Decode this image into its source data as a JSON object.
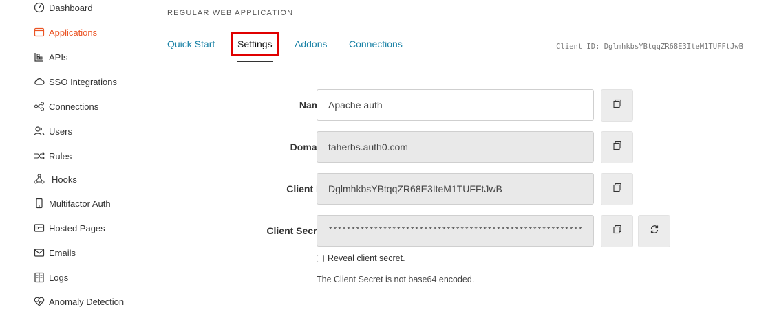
{
  "sidebar": {
    "items": [
      {
        "label": "Dashboard",
        "icon": "dashboard-icon",
        "active": false
      },
      {
        "label": "Applications",
        "icon": "applications-icon",
        "active": true
      },
      {
        "label": "APIs",
        "icon": "apis-icon",
        "active": false
      },
      {
        "label": "SSO Integrations",
        "icon": "cloud-icon",
        "active": false
      },
      {
        "label": "Connections",
        "icon": "connections-icon",
        "active": false
      },
      {
        "label": "Users",
        "icon": "users-icon",
        "active": false
      },
      {
        "label": "Rules",
        "icon": "rules-icon",
        "active": false
      },
      {
        "label": "Hooks",
        "icon": "hooks-icon",
        "active": false
      },
      {
        "label": "Multifactor Auth",
        "icon": "phone-icon",
        "active": false
      },
      {
        "label": "Hosted Pages",
        "icon": "hosted-pages-icon",
        "active": false
      },
      {
        "label": "Emails",
        "icon": "mail-icon",
        "active": false
      },
      {
        "label": "Logs",
        "icon": "logs-icon",
        "active": false
      },
      {
        "label": "Anomaly Detection",
        "icon": "heart-icon",
        "active": false
      }
    ]
  },
  "header": {
    "app_type": "REGULAR WEB APPLICATION",
    "client_id_label": "Client ID: DglmhkbsYBtqqZR68E3IteM1TUFFtJwB"
  },
  "tabs": [
    {
      "label": "Quick Start",
      "active": false
    },
    {
      "label": "Settings",
      "active": true
    },
    {
      "label": "Addons",
      "active": false
    },
    {
      "label": "Connections",
      "active": false
    }
  ],
  "form": {
    "name": {
      "label": "Name",
      "value": "Apache auth"
    },
    "domain": {
      "label": "Domain",
      "value": "taherbs.auth0.com"
    },
    "client_id": {
      "label": "Client ID",
      "value": "DglmhkbsYBtqqZR68E3IteM1TUFFtJwB"
    },
    "client_secret": {
      "label": "Client Secret",
      "value": "****************************************************************"
    },
    "reveal_label": "Reveal client secret.",
    "note": "The Client Secret is not base64 encoded."
  },
  "colors": {
    "accent": "#eb5424",
    "link": "#1a82a6",
    "highlight": "#e00000"
  }
}
